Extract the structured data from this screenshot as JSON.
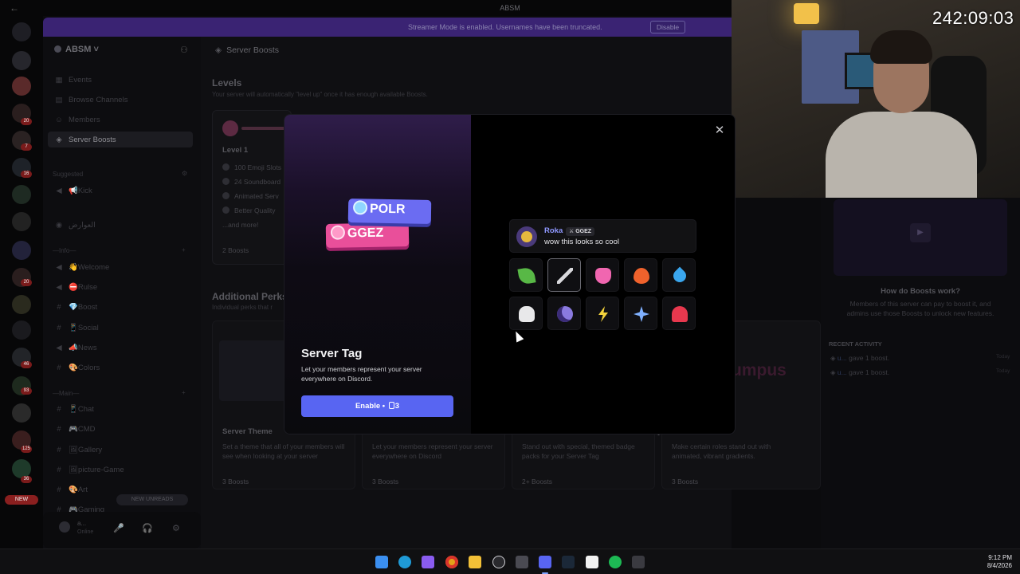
{
  "window": {
    "title": "ABSM"
  },
  "banner": {
    "message": "Streamer Mode is enabled. Usernames have been truncated.",
    "disable_label": "Disable"
  },
  "rail": {
    "badges": [
      "20",
      "7",
      "16",
      "20",
      "46",
      "93",
      "125",
      "36"
    ],
    "new_label": "NEW"
  },
  "sidebar": {
    "server_name": "ABSM",
    "nav": [
      {
        "label": "Events",
        "icon": "calendar-icon"
      },
      {
        "label": "Browse Channels",
        "icon": "browse-icon"
      },
      {
        "label": "Members",
        "icon": "members-icon"
      },
      {
        "label": "Server Boosts",
        "icon": "boost-icon"
      }
    ],
    "suggested_label": "Suggested",
    "suggested_channel": "📢Kick",
    "admin_channel": "العوارض",
    "info_category": "—Info—",
    "info_channels": [
      "👋Welcome",
      "⛔Rulse",
      "💎Boost",
      "📱Social",
      "📣News",
      "🎨Colors"
    ],
    "main_category": "—Main—",
    "main_channels": [
      "📱Chat",
      "🎮CMD",
      "🖼Gallery",
      "🖼picture-Game",
      "🎨Art",
      "🎮Gaming"
    ],
    "new_unreads": "NEW UNREADS",
    "user": {
      "name": "a...",
      "status": "Online"
    }
  },
  "main": {
    "header": "Server Boosts",
    "levels_title": "Levels",
    "levels_sub": "Your server will automatically \"level up\" once it has enough available Boosts.",
    "level_card": {
      "title": "Level 1",
      "perks": [
        "100 Emoji Slots",
        "24 Soundboard",
        "Animated Serv",
        "Better Quality"
      ],
      "more": "...and more!",
      "boosts": "2 Boosts"
    },
    "additional_title": "Additional Perks",
    "additional_sub": "Individual perks that r",
    "perk_cards": [
      {
        "title": "Server Theme",
        "desc": "Set a theme that all of your members will see when looking at your server",
        "boosts": "3 Boosts"
      },
      {
        "title": "",
        "desc": "Let your members represent your server everywhere on Discord",
        "boosts": "3 Boosts"
      },
      {
        "title": "",
        "desc": "Stand out with special, themed badge packs for your Server Tag",
        "boosts": "2+ Boosts"
      },
      {
        "title": "yles",
        "desc": "Make certain roles stand out with animated, vibrant gradients.",
        "boosts": "3 Boosts"
      }
    ],
    "wordmark": "umpus"
  },
  "right_panel": {
    "question": "How do Boosts work?",
    "answer": "Members of this server can pay to boost it, and admins use those Boosts to unlock new features.",
    "recent_activity_label": "RECENT ACTIVITY",
    "activity": [
      {
        "user": "u...",
        "action": "gave 1 boost.",
        "when": "Today"
      },
      {
        "user": "u...",
        "action": "gave 1 boost.",
        "when": "Today"
      }
    ]
  },
  "webcam": {
    "timer": "242:09:03"
  },
  "modal": {
    "tags": [
      {
        "label": "POLR"
      },
      {
        "label": "GGEZ"
      }
    ],
    "title": "Server Tag",
    "description": "Let your members represent your server everywhere on Discord.",
    "enable_label": "Enable",
    "enable_sep": "•",
    "enable_count": "3",
    "preview": {
      "name": "Roka",
      "tag": "GGEZ",
      "message": "wow this looks so cool"
    },
    "badges": [
      "leaf-badge",
      "sword-badge",
      "heart-badge",
      "flame-badge",
      "drop-badge",
      "skull-badge",
      "moon-badge",
      "bolt-badge",
      "sparkle-badge",
      "mushroom-badge"
    ],
    "selected_badge": 1,
    "close_symbol": "✕"
  },
  "taskbar": {
    "icons": [
      "windows-start-icon",
      "edge-icon",
      "copilot-icon",
      "chrome-icon",
      "file-explorer-icon",
      "obs-icon",
      "calculator-icon",
      "discord-icon",
      "steam-icon",
      "capcut-icon",
      "spotify-icon",
      "capture-icon"
    ],
    "time": "9:12 PM",
    "date": "8/4/2026"
  },
  "colors": {
    "accent": "#5865f2",
    "banner": "#3a2373",
    "ggez": "#e94f9a",
    "polr": "#6b6cf2"
  }
}
